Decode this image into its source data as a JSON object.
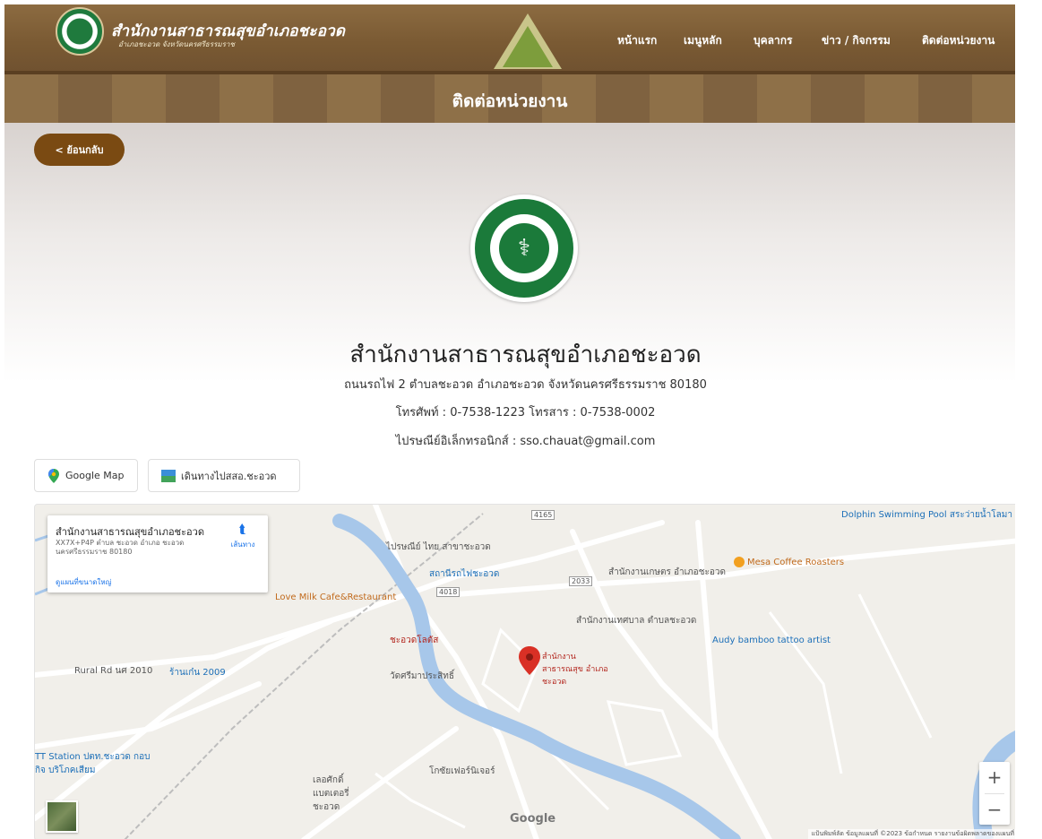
{
  "header": {
    "brand_title": "สำนักงานสาธารณสุขอำเภอชะอวด",
    "brand_subtitle": "อำเภอชะอวด จังหวัดนครศรีธรรมราช",
    "nav": [
      "หน้าแรก",
      "เมนูหลัก",
      "บุคลากร",
      "ข่าว / กิจกรรม",
      "ติดต่อหน่วยงาน"
    ]
  },
  "banner": {
    "title": "ติดต่อหน่วยงาน"
  },
  "back_button": {
    "label": "< ย้อนกลับ"
  },
  "seal": {
    "icon": "ministry-of-public-health-seal"
  },
  "org": {
    "name": "สำนักงานสาธารณสุขอำเภอชะอวด",
    "address": "ถนนรถไฟ 2 ตำบลชะอวด อำเภอชะอวด จังหวัดนครศรีธรรมราช 80180",
    "phone": "โทรศัพท์ : 0-7538-1223 โทรสาร : 0-7538-0002",
    "email": "ไปรษณีย์อิเล็กทรอนิกส์ : sso.chauat@gmail.com"
  },
  "buttons": {
    "google_map": "Google Map",
    "directions": "เดินทางไปสสอ.ชะอวด"
  },
  "map": {
    "infocard": {
      "title": "สำนักงานสาธารณสุขอำเภอชะอวด",
      "address": "XX7X+P4P ตำบล ชะอวด อำเภอ ชะอวด นครศรีธรรมราช 80180",
      "directions": "เส้นทาง",
      "view_larger": "ดูแผนที่ขนาดใหญ่"
    },
    "labels": {
      "marker": "สำนักงานสาธารณสุข อำเภอชะอวด",
      "dolphin": "Dolphin Swimming Pool สระว่ายน้ำโลมา",
      "mesa": "Mesa Coffee Roasters",
      "love_milk": "Love Milk Cafe&Restaurant",
      "post": "ไปรษณีย์ ไทย สาขาชะอวด",
      "station": "สถานีรถไฟชะอวด",
      "khet": "สำนักงานเกษตร อำเภอชะอวด",
      "muni": "สำนักงานเทศบาล ตำบลชะอวด",
      "tesco": "ชะอวดโลตัส",
      "audy": "Audy bamboo tattoo artist",
      "wat": "วัดศรีมาประสิทธิ์",
      "rural": "Rural Rd นศ 2010",
      "shop2009": "ร้านเก๋น 2009",
      "ptt": "TT Station ปตท.ชะอวด กอบกิจ บริโภคเสียม",
      "store": "โกซัยเฟอร์นิเจอร์",
      "battery": "เลอศักดิ์ แบตเตอรี่ชะอวด",
      "road4018": "4018",
      "road4165": "4165",
      "road2033": "2033"
    },
    "attribution": "แป้นพิมพ์ลัด ข้อมูลแผนที่ ©2023 ข้อกำหนด รายงานข้อผิดพลาดของแผนที่",
    "google": "Google"
  },
  "colors": {
    "header": "#7a5a33",
    "back_button": "#7a4a12",
    "seal_green": "#1b7a3a",
    "map_river": "#a7c7ea",
    "marker": "#d93025"
  }
}
